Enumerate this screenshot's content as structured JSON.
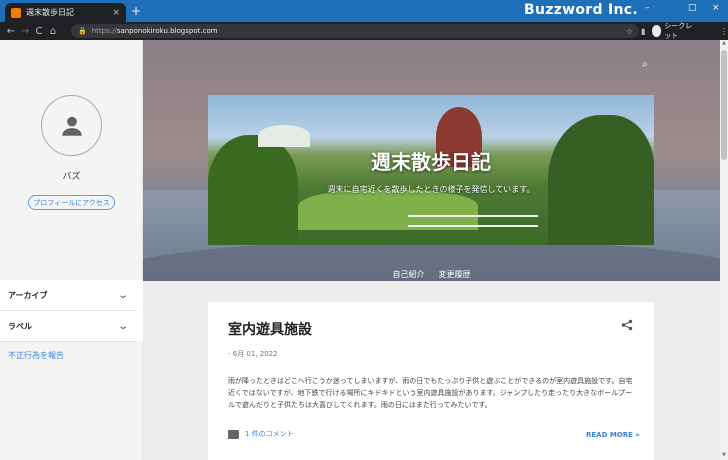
{
  "browser": {
    "tab_title": "週末散歩日記",
    "tab_close": "×",
    "new_tab": "+",
    "brand": "Buzzword Inc.",
    "window_controls": [
      "–",
      "□",
      "×"
    ],
    "nav_back": "←",
    "nav_forward": "→",
    "nav_reload": "C",
    "nav_home": "⌂",
    "url_scheme": "https://",
    "url_host": "sanponokiroku.blogspot.com",
    "lock_icon": "🔒",
    "star_icon": "☆",
    "incognito_label": "シークレット",
    "menu_icon": "⋮"
  },
  "sidebar": {
    "profile_name": "バズ",
    "profile_button": "プロフィールにアクセス",
    "sections": [
      {
        "label": "アーカイブ",
        "chevron": "⌄"
      },
      {
        "label": "ラベル",
        "chevron": "⌄"
      }
    ],
    "report_link": "不正行為を報告"
  },
  "header": {
    "search_icon": "⌕",
    "blog_title": "週末散歩日記",
    "blog_description": "週末に自宅近くを散歩したときの様子を発信しています。",
    "nav": [
      "自己紹介",
      "変更履歴"
    ]
  },
  "post": {
    "title": "室内遊具施設",
    "date": "- 6月 01, 2022",
    "body": "雨が降ったときはどこへ行こうか迷ってしまいますが、雨の日でもたっぷり子供と遊ぶことができるのが室内遊具施設です。自宅近くではないですが、地下鉄で行ける場所にキドキドという室内遊具施設があります。ジャンプしたり走ったり大きなボールプールで遊んだりと子供たちは大喜びしてくれます。雨の日にはまた行ってみたいです。",
    "comments": "1 件のコメント",
    "read_more": "READ MORE »"
  }
}
